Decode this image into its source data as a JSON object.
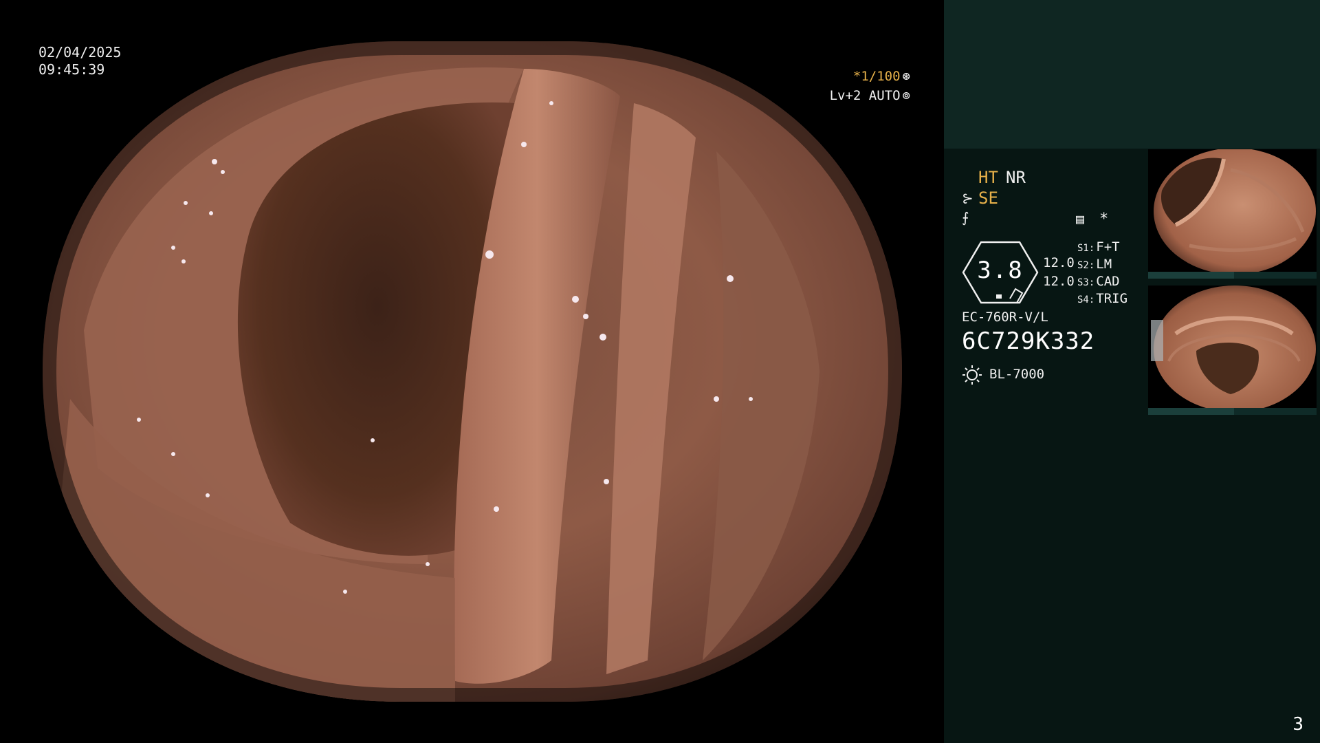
{
  "overlay": {
    "date": "02/04/2025",
    "time": "09:45:39",
    "shutter": "*1/100",
    "shutter_icon": "⊛",
    "level": "Lv+2 AUTO",
    "level_icon": "⊚"
  },
  "panel": {
    "ht": "HT",
    "nr": "NR",
    "se": "SE",
    "se_icon": "⊱",
    "freeze_icon": "⨍",
    "settings_icon": "▤",
    "star_icon": "*",
    "gauge_value": "3.8",
    "value1": "12.0",
    "value2": "12.0",
    "switches": [
      {
        "key": "S1:",
        "value": "F+T"
      },
      {
        "key": "S2:",
        "value": "LM"
      },
      {
        "key": "S3:",
        "value": "CAD"
      },
      {
        "key": "S4:",
        "value": "TRIG"
      }
    ],
    "scope_model": "EC-760R-V/L",
    "serial": "6C729K332",
    "light_source": "BL-7000"
  },
  "page_number": "3",
  "colors": {
    "accent": "#e7b14a",
    "panel_bg": "#071613",
    "panel_top": "#0f2622"
  }
}
